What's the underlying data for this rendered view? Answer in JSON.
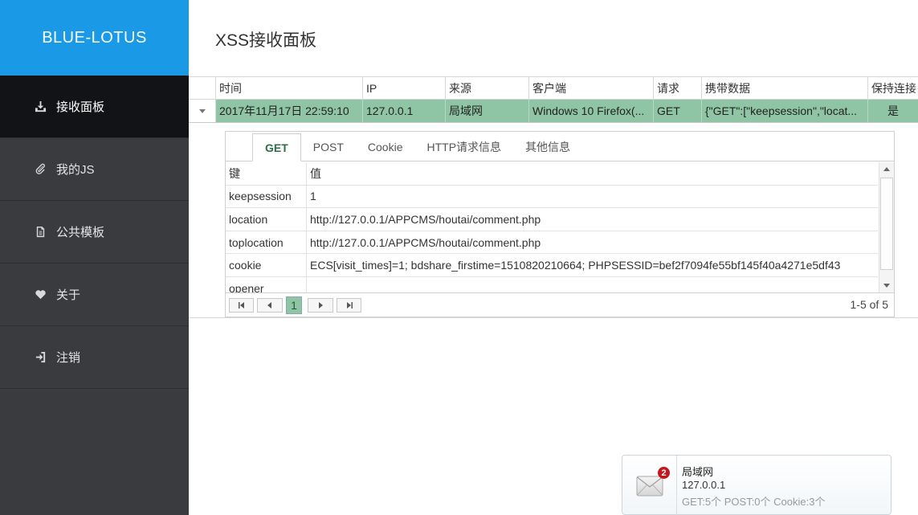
{
  "app": {
    "brand": "BLUE-LOTUS",
    "page_title": "XSS接收面板"
  },
  "sidebar": {
    "items": [
      {
        "label": "接收面板",
        "icon": "download-icon",
        "active": true
      },
      {
        "label": "我的JS",
        "icon": "paperclip-icon",
        "active": false
      },
      {
        "label": "公共模板",
        "icon": "document-icon",
        "active": false
      },
      {
        "label": "关于",
        "icon": "heart-icon",
        "active": false
      },
      {
        "label": "注销",
        "icon": "logout-icon",
        "active": false
      }
    ]
  },
  "grid": {
    "columns": [
      "时间",
      "IP",
      "来源",
      "客户端",
      "请求",
      "携带数据",
      "保持连接"
    ],
    "row": {
      "time": "2017年11月17日 22:59:10",
      "ip": "127.0.0.1",
      "source": "局域网",
      "client": "Windows 10 Firefox(...",
      "method": "GET",
      "data": "{\"GET\":[\"keepsession\",\"locat...",
      "keep": "是"
    }
  },
  "detail": {
    "tabs": [
      "GET",
      "POST",
      "Cookie",
      "HTTP请求信息",
      "其他信息"
    ],
    "active_tab": "GET",
    "header": {
      "key": "键",
      "value": "值"
    },
    "rows": [
      {
        "key": "keepsession",
        "value": "1"
      },
      {
        "key": "location",
        "value": "http://127.0.0.1/APPCMS/houtai/comment.php"
      },
      {
        "key": "toplocation",
        "value": "http://127.0.0.1/APPCMS/houtai/comment.php"
      },
      {
        "key": "cookie",
        "value": "ECS[visit_times]=1; bdshare_firstime=1510820210664; PHPSESSID=bef2f7094fe55bf145f40a4271e5df43"
      },
      {
        "key": "opener",
        "value": ""
      }
    ],
    "pager": {
      "current_page": "1",
      "info": "1-5 of 5"
    }
  },
  "notification": {
    "badge": "2",
    "title": "局域网",
    "ip": "127.0.0.1",
    "stats": "GET:5个 POST:0个 Cookie:3个"
  },
  "colors": {
    "brand_bg": "#1a9ae6",
    "sidebar_bg": "#3a3b3f",
    "row_selected": "#8fc5a4",
    "badge": "#c4161c"
  }
}
